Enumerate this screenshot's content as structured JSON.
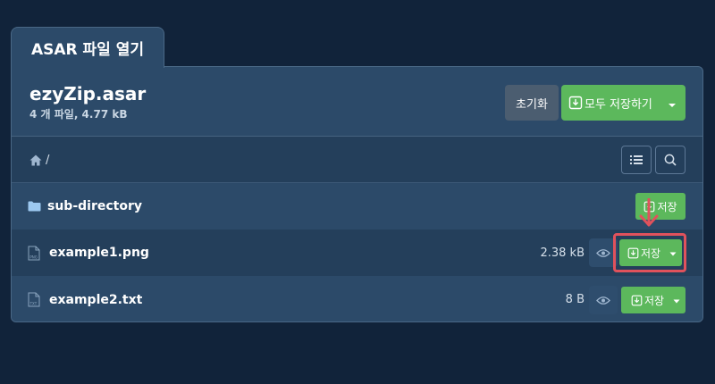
{
  "tab": {
    "label": "ASAR 파일 열기"
  },
  "archive": {
    "name": "ezyZip.asar",
    "summary": "4 개 파일, 4.77 kB"
  },
  "actions": {
    "reset_label": "초기화",
    "save_all_label": "모두 저장하기"
  },
  "breadcrumb": {
    "path": "/"
  },
  "rows": [
    {
      "name": "sub-directory",
      "icon": "folder-icon",
      "size": "",
      "save_label": "저장"
    },
    {
      "name": "example1.png",
      "icon": "png-file-icon",
      "size": "2.38 kB",
      "save_label": "저장"
    },
    {
      "name": "example2.txt",
      "icon": "txt-file-icon",
      "size": "8 B",
      "save_label": "저장"
    }
  ],
  "colors": {
    "accent": "#5cb85c",
    "highlight": "#e0525c",
    "background": "#11233a",
    "panel": "#2c4a69"
  }
}
